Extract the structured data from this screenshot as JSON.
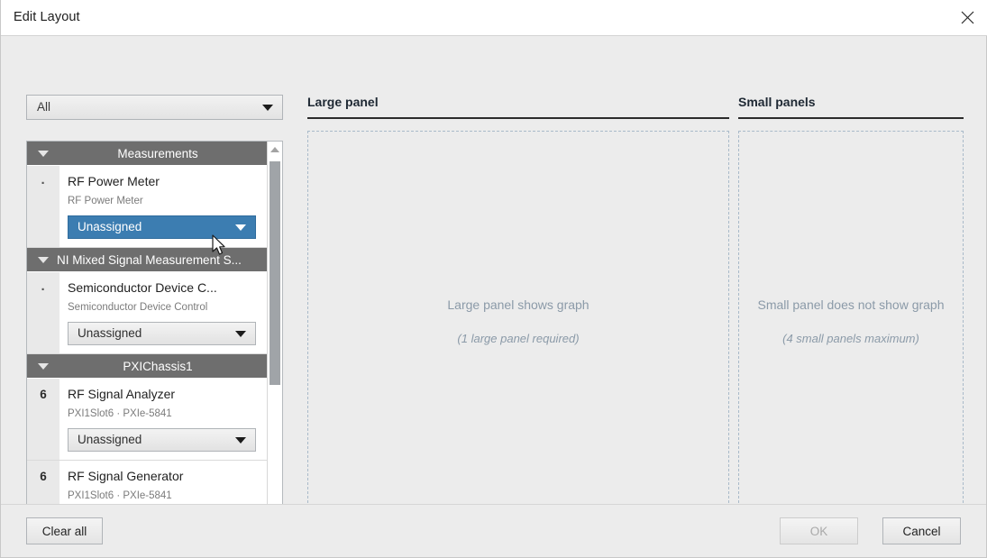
{
  "window": {
    "title": "Edit Layout",
    "close_icon": "close-icon"
  },
  "filter": {
    "selected": "All",
    "arrow_icon": "chevron-down-icon"
  },
  "resource_list": {
    "scrollbar": {
      "up_icon": "scroll-up-arrow-icon",
      "down_icon": "scroll-down-arrow-icon"
    },
    "groups": [
      {
        "title": "Measurements",
        "align": "center",
        "collapse_icon": "triangle-down-icon",
        "devices": [
          {
            "slot": "·",
            "slot_is_dot": true,
            "name": "RF Power Meter",
            "sub": "RF Power Meter",
            "assignment": "Unassigned",
            "highlighted": true
          }
        ]
      },
      {
        "title": "NI Mixed Signal Measurement S...",
        "align": "left",
        "collapse_icon": "triangle-down-icon",
        "devices": [
          {
            "slot": "·",
            "slot_is_dot": true,
            "name": "Semiconductor Device C...",
            "sub": "Semiconductor Device Control",
            "assignment": "Unassigned",
            "highlighted": false
          }
        ]
      },
      {
        "title": "PXIChassis1",
        "align": "center",
        "collapse_icon": "triangle-down-icon",
        "devices": [
          {
            "slot": "6",
            "slot_is_dot": false,
            "name": "RF Signal Analyzer",
            "sub": "PXI1Slot6  ·  PXIe-5841",
            "assignment": "Unassigned",
            "highlighted": false
          },
          {
            "slot": "6",
            "slot_is_dot": false,
            "name": "RF Signal Generator",
            "sub": "PXI1Slot6  ·  PXIe-5841",
            "assignment": null,
            "highlighted": false
          }
        ]
      }
    ]
  },
  "panels": {
    "large": {
      "header": "Large panel",
      "line1": "Large panel shows graph",
      "line2": "(1 large panel required)"
    },
    "small": {
      "header": "Small panels",
      "line1": "Small panel does not show graph",
      "line2": "(4 small panels maximum)"
    }
  },
  "footer": {
    "clear_all": "Clear all",
    "ok": "OK",
    "cancel": "Cancel"
  },
  "colors": {
    "dialog_bg": "#ececec",
    "group_header_bg": "#6e6e6e",
    "highlight_blue": "#3c7db1",
    "dashed_border": "#a9bac9",
    "placeholder_text": "#8b9aa8"
  }
}
